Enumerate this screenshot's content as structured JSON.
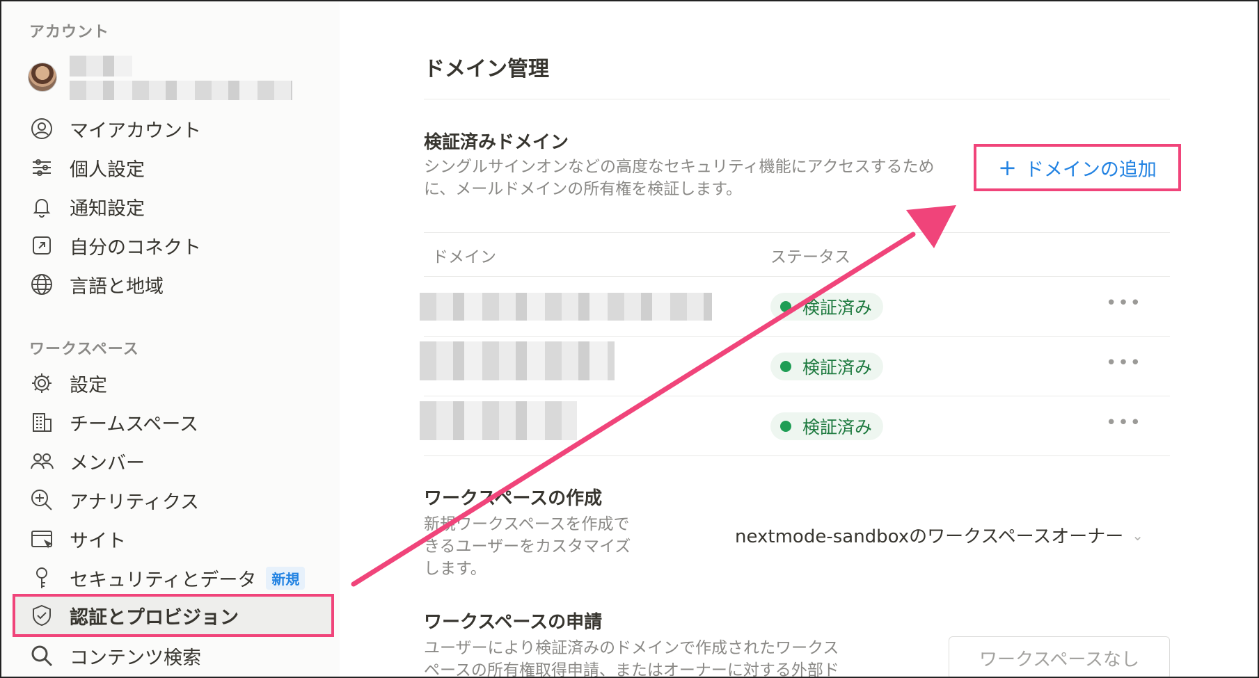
{
  "sidebar": {
    "account_label": "アカウント",
    "workspace_label": "ワークスペース",
    "account_items": [
      {
        "label": "マイアカウント",
        "icon": "user-circle-icon"
      },
      {
        "label": "個人設定",
        "icon": "sliders-icon"
      },
      {
        "label": "通知設定",
        "icon": "bell-icon"
      },
      {
        "label": "自分のコネクト",
        "icon": "external-link-icon"
      },
      {
        "label": "言語と地域",
        "icon": "globe-icon"
      }
    ],
    "workspace_items": [
      {
        "label": "設定",
        "icon": "gear-icon"
      },
      {
        "label": "チームスペース",
        "icon": "building-icon"
      },
      {
        "label": "メンバー",
        "icon": "people-icon"
      },
      {
        "label": "アナリティクス",
        "icon": "analytics-search-icon"
      },
      {
        "label": "サイト",
        "icon": "browser-cursor-icon"
      },
      {
        "label": "セキュリティとデータ",
        "icon": "key-icon",
        "badge": "新規"
      },
      {
        "label": "認証とプロビジョン",
        "icon": "shield-check-icon"
      },
      {
        "label": "コンテンツ検索",
        "icon": "search-icon"
      }
    ]
  },
  "main": {
    "title": "ドメイン管理",
    "verified_heading": "検証済みドメイン",
    "verified_desc_line1": "シングルサインオンなどの高度なセキュリティ機能にアクセスするため",
    "verified_desc_line2": "に、メールドメインの所有権を検証します。",
    "add_domain_label": "ドメインの追加",
    "table": {
      "col_domain": "ドメイン",
      "col_status": "ステータス",
      "rows": [
        {
          "status": "検証済み"
        },
        {
          "status": "検証済み"
        },
        {
          "status": "検証済み"
        }
      ]
    },
    "create_heading": "ワークスペースの作成",
    "create_desc_line1": "新規ワークスペースを作成で",
    "create_desc_line2": "きるユーザーをカスタマイズ",
    "create_desc_line3": "します。",
    "create_value": "nextmode-sandboxのワークスペースオーナー",
    "request_heading": "ワークスペースの申請",
    "request_desc_line1": "ユーザーにより検証済みのドメインで作成されたワークス",
    "request_desc_line2": "ペースの所有権取得申請、またはオーナーに対する外部ド",
    "request_value": "ワークスペースなし"
  },
  "colors": {
    "highlight": "#f0447a",
    "accent_blue": "#2383e2",
    "verified_green": "#1f9d55"
  }
}
